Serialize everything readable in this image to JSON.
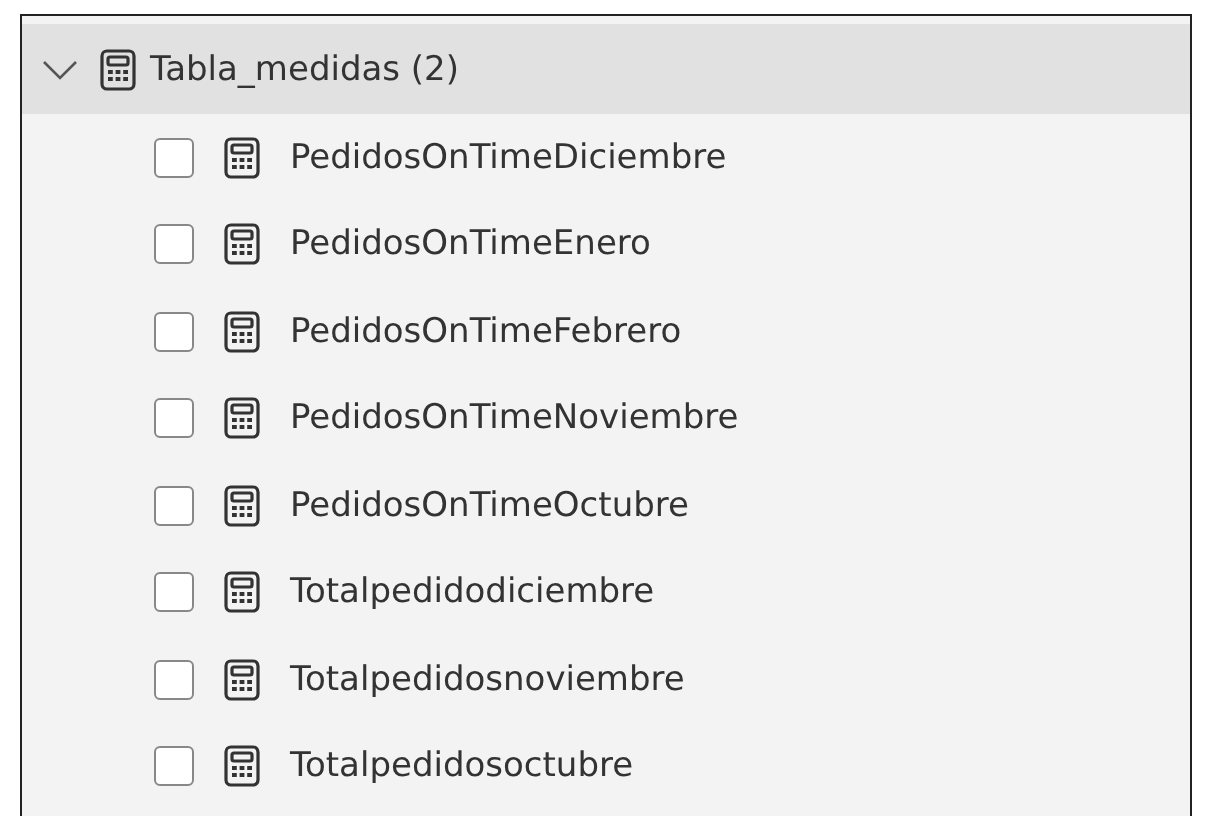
{
  "table": {
    "name": "Tabla_medidas (2)",
    "expanded": true,
    "fields": [
      {
        "name": "PedidosOnTimeDiciembre",
        "checked": false
      },
      {
        "name": "PedidosOnTimeEnero",
        "checked": false
      },
      {
        "name": "PedidosOnTimeFebrero",
        "checked": false
      },
      {
        "name": "PedidosOnTimeNoviembre",
        "checked": false
      },
      {
        "name": "PedidosOnTimeOctubre",
        "checked": false
      },
      {
        "name": "Totalpedidodiciembre",
        "checked": false
      },
      {
        "name": "Totalpedidosnoviembre",
        "checked": false
      },
      {
        "name": "Totalpedidosoctubre",
        "checked": false
      }
    ]
  }
}
